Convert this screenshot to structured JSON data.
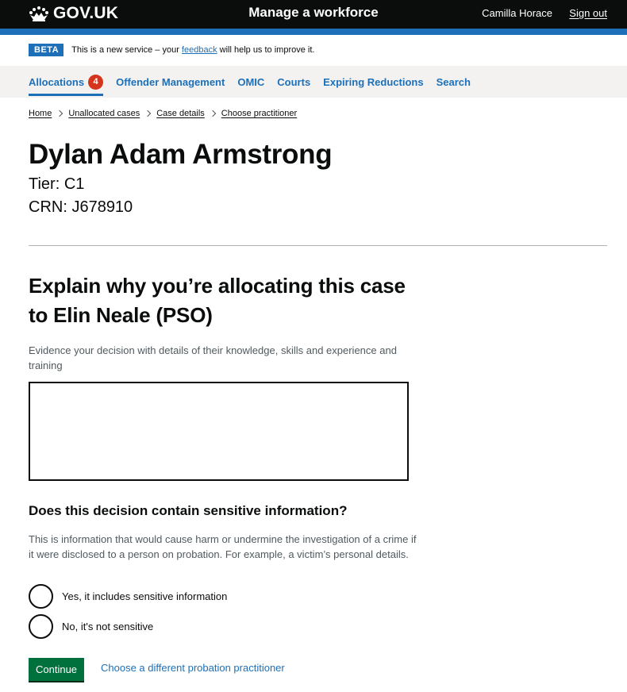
{
  "header": {
    "logo_text": "GOV.UK",
    "service_name": "Manage a workforce",
    "user_name": "Camilla Horace",
    "sign_out": "Sign out"
  },
  "phase_banner": {
    "tag": "BETA",
    "text_before": "This is a new service – your ",
    "link": "feedback",
    "text_after": " will help us to improve it."
  },
  "nav": {
    "items": [
      {
        "label": "Allocations",
        "badge": "4",
        "active": true
      },
      {
        "label": "Offender Management"
      },
      {
        "label": "OMIC"
      },
      {
        "label": "Courts"
      },
      {
        "label": "Expiring Reductions"
      },
      {
        "label": "Search"
      }
    ]
  },
  "breadcrumbs": [
    "Home",
    "Unallocated cases",
    "Case details",
    "Choose practitioner"
  ],
  "person": {
    "name": "Dylan Adam Armstrong",
    "tier": "Tier: C1",
    "crn": "CRN: J678910"
  },
  "form": {
    "heading": "Explain why you’re allocating this case to Elin Neale (PSO)",
    "hint": "Evidence your decision with details of their knowledge, skills and experience and training",
    "textarea_value": "",
    "sensitive_legend": "Does this decision contain sensitive information?",
    "sensitive_hint": "This is information that would cause harm or undermine the investigation of a crime if it were disclosed to a person on probation. For example, a victim’s personal details.",
    "options": [
      "Yes, it includes sensitive information",
      "No, it's not sensitive"
    ],
    "continue_label": "Continue",
    "other_link": "Choose a different probation practitioner"
  },
  "colors": {
    "header": "#0b0c0c",
    "brand_blue": "#1d70b8",
    "button_green": "#00703c",
    "badge_red": "#d4351c"
  }
}
